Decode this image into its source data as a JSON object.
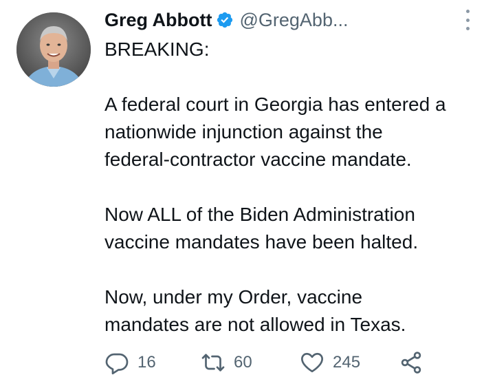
{
  "tweet": {
    "author": {
      "name": "Greg Abbott",
      "handle": "@GregAbb...",
      "verified": true,
      "avatar": "profile-photo"
    },
    "body": [
      "BREAKING:",
      "",
      "A federal court in Georgia has entered a",
      "nationwide injunction against the",
      "federal-contractor vaccine mandate.",
      "",
      "Now ALL of the Biden Administration",
      "vaccine mandates have been halted.",
      "",
      "Now, under my Order, vaccine",
      "mandates are not allowed in Texas."
    ],
    "actions": {
      "reply": {
        "icon": "reply-icon",
        "count": "16"
      },
      "retweet": {
        "icon": "retweet-icon",
        "count": "60"
      },
      "like": {
        "icon": "heart-icon",
        "count": "245"
      },
      "share": {
        "icon": "share-icon"
      }
    }
  },
  "colors": {
    "text": "#0f1419",
    "secondary": "#536471",
    "verified_blue": "#1d9bf0",
    "icon_gray": "#536471"
  }
}
